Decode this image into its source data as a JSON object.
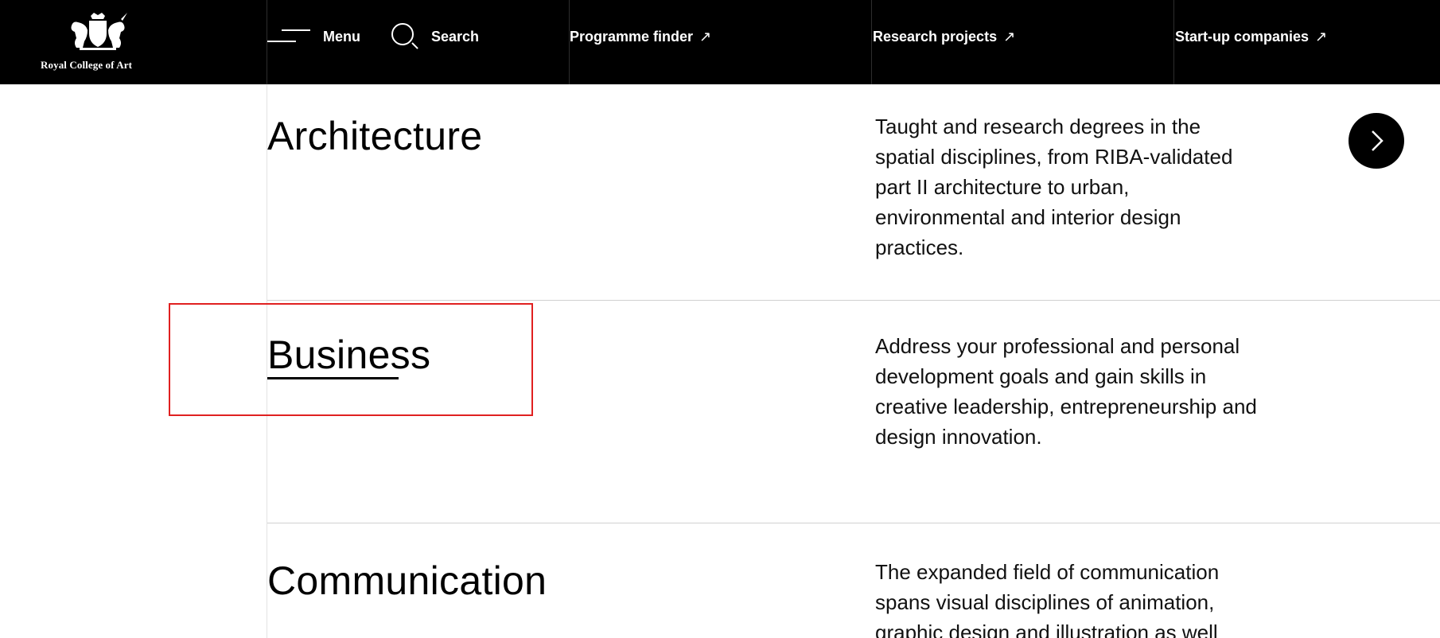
{
  "header": {
    "logo_text": "Royal College of Art",
    "menu_label": "Menu",
    "search_label": "Search",
    "links": [
      {
        "label": "Programme finder",
        "arrow": "↗"
      },
      {
        "label": "Research projects",
        "arrow": "↗"
      },
      {
        "label": "Start-up companies",
        "arrow": "↗"
      }
    ]
  },
  "programmes": [
    {
      "title": "Architecture",
      "description": "Taught and research degrees in the spatial disciplines, from RIBA-validated part II architecture to urban, environmental and interior design practices."
    },
    {
      "title": "Business",
      "description": "Address your professional and personal development goals and gain skills in creative leadership, entrepreneurship and design innovation."
    },
    {
      "title": "Communication",
      "description": "The expanded field of communication spans visual disciplines of animation, graphic design and illustration as well"
    }
  ],
  "icons": {
    "menu": "menu-icon",
    "search": "search-icon",
    "next": "chevron-right-icon",
    "crest": "royal-crest-icon"
  },
  "colors": {
    "header_bg": "#000000",
    "highlight": "#e02020"
  }
}
